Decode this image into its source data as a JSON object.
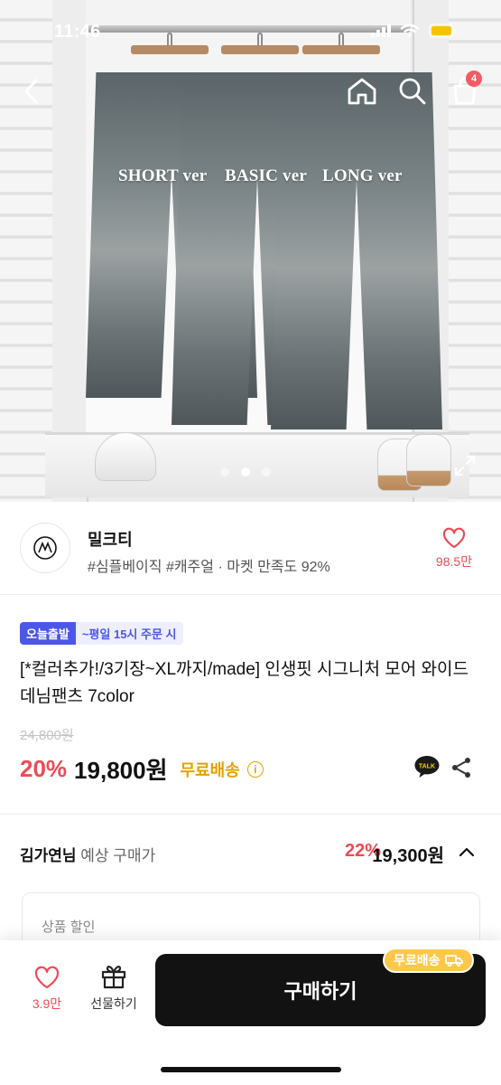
{
  "status_bar": {
    "time": "11:46"
  },
  "nav": {
    "cart_count": "4"
  },
  "hero": {
    "labels": [
      "SHORT ver",
      "BASIC ver",
      "LONG ver"
    ],
    "active_slide": 2,
    "slide_count": 3
  },
  "store": {
    "name": "밀크티",
    "tags": "#심플베이직 #캐주얼 · 마켓 만족도 92%",
    "favorite_count": "98.5만"
  },
  "product": {
    "badge_today": "오늘출발",
    "badge_time": "~평일 15시 주문 시",
    "title": "[*컬러추가!/3기장~XL까지/made] 인생핏 시그니처 모어 와이드 데님팬츠 7color",
    "original_price": "24,800원",
    "discount_rate": "20%",
    "price": "19,800원",
    "shipping": "무료배송"
  },
  "expected_price": {
    "user_name": "김가연님",
    "label": "예상 구매가",
    "rate": "22%",
    "amount": "19,300원"
  },
  "discount_box": {
    "label": "상품 할인"
  },
  "bottom_bar": {
    "like_count": "3.9만",
    "gift_label": "선물하기",
    "buy_label": "구매하기",
    "shipping_chip": "무료배송"
  },
  "colors": {
    "accent_red": "#f04a55",
    "today_blue": "#4c56e9",
    "shipping_yellow": "#e6a100",
    "buy_button": "#121212"
  },
  "icons": [
    "back-icon",
    "home-icon",
    "search-icon",
    "cart-icon",
    "heart-icon",
    "info-icon",
    "kakao-talk-icon",
    "share-icon",
    "chevron-up-icon",
    "gift-icon",
    "truck-icon",
    "expand-icon"
  ]
}
